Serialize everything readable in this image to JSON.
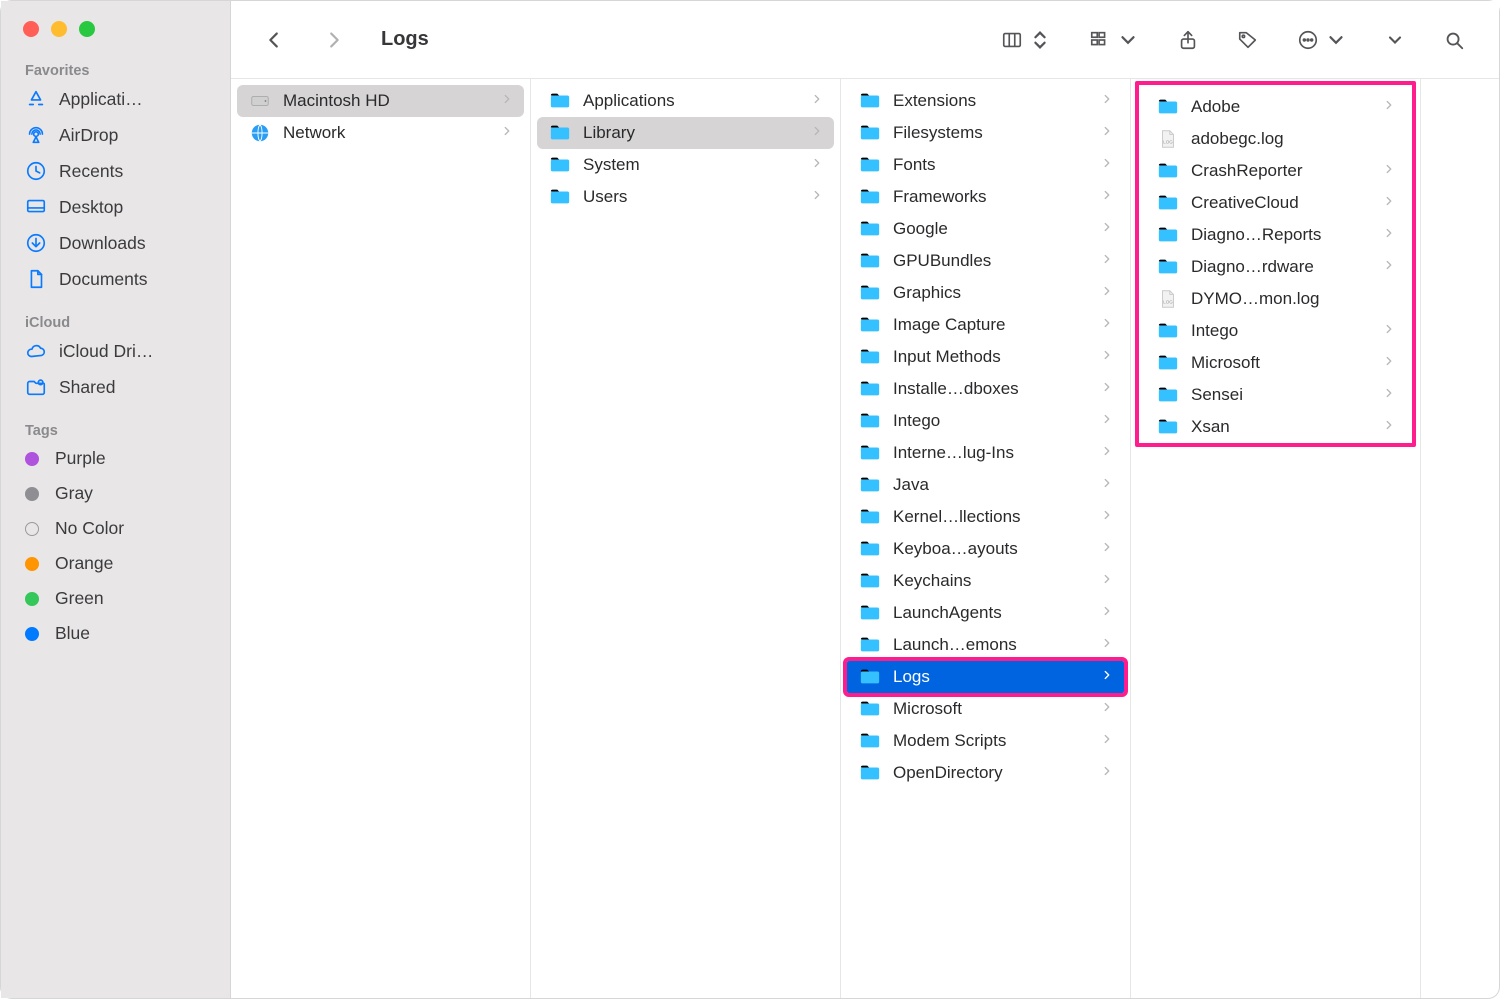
{
  "window": {
    "title": "Logs"
  },
  "sidebar": {
    "favorites_label": "Favorites",
    "favorites": [
      {
        "label": "Applicati…",
        "icon": "appstore"
      },
      {
        "label": "AirDrop",
        "icon": "airdrop"
      },
      {
        "label": "Recents",
        "icon": "clock"
      },
      {
        "label": "Desktop",
        "icon": "desktop"
      },
      {
        "label": "Downloads",
        "icon": "download"
      },
      {
        "label": "Documents",
        "icon": "doc"
      }
    ],
    "icloud_label": "iCloud",
    "icloud": [
      {
        "label": "iCloud Dri…",
        "icon": "cloud"
      },
      {
        "label": "Shared",
        "icon": "shared"
      }
    ],
    "tags_label": "Tags",
    "tags": [
      {
        "label": "Purple",
        "color": "#af52de"
      },
      {
        "label": "Gray",
        "color": "#8e8e93"
      },
      {
        "label": "No Color",
        "color": "transparent"
      },
      {
        "label": "Orange",
        "color": "#ff9500"
      },
      {
        "label": "Green",
        "color": "#34c759"
      },
      {
        "label": "Blue",
        "color": "#007aff"
      }
    ]
  },
  "columns": [
    {
      "items": [
        {
          "label": "Macintosh HD",
          "icon": "hd",
          "chevron": true,
          "selected": "gray"
        },
        {
          "label": "Network",
          "icon": "globe",
          "chevron": true
        }
      ]
    },
    {
      "items": [
        {
          "label": "Applications",
          "icon": "folder",
          "chevron": true
        },
        {
          "label": "Library",
          "icon": "folder",
          "chevron": true,
          "selected": "gray"
        },
        {
          "label": "System",
          "icon": "folder",
          "chevron": true
        },
        {
          "label": "Users",
          "icon": "folder",
          "chevron": true
        }
      ]
    },
    {
      "items": [
        {
          "label": "Extensions",
          "icon": "folder",
          "chevron": true
        },
        {
          "label": "Filesystems",
          "icon": "folder",
          "chevron": true
        },
        {
          "label": "Fonts",
          "icon": "folder",
          "chevron": true
        },
        {
          "label": "Frameworks",
          "icon": "folder",
          "chevron": true
        },
        {
          "label": "Google",
          "icon": "folder",
          "chevron": true
        },
        {
          "label": "GPUBundles",
          "icon": "folder",
          "chevron": true
        },
        {
          "label": "Graphics",
          "icon": "folder",
          "chevron": true
        },
        {
          "label": "Image Capture",
          "icon": "folder",
          "chevron": true
        },
        {
          "label": "Input Methods",
          "icon": "folder",
          "chevron": true
        },
        {
          "label": "Installe…dboxes",
          "icon": "folder",
          "chevron": true
        },
        {
          "label": "Intego",
          "icon": "folder",
          "chevron": true
        },
        {
          "label": "Interne…lug-Ins",
          "icon": "folder",
          "chevron": true
        },
        {
          "label": "Java",
          "icon": "folder",
          "chevron": true
        },
        {
          "label": "Kernel…llections",
          "icon": "folder",
          "chevron": true
        },
        {
          "label": "Keyboa…ayouts",
          "icon": "folder",
          "chevron": true
        },
        {
          "label": "Keychains",
          "icon": "folder",
          "chevron": true
        },
        {
          "label": "LaunchAgents",
          "icon": "folder",
          "chevron": true
        },
        {
          "label": "Launch…emons",
          "icon": "folder",
          "chevron": true
        },
        {
          "label": "Logs",
          "icon": "folder",
          "chevron": true,
          "selected": "blue"
        },
        {
          "label": "Microsoft",
          "icon": "folder",
          "chevron": true
        },
        {
          "label": "Modem Scripts",
          "icon": "folder",
          "chevron": true
        },
        {
          "label": "OpenDirectory",
          "icon": "folder",
          "chevron": true
        }
      ],
      "pink_outline_selected": true
    },
    {
      "pink_outline_column": true,
      "items": [
        {
          "label": "Adobe",
          "icon": "folder",
          "chevron": true
        },
        {
          "label": "adobegc.log",
          "icon": "file",
          "chevron": false
        },
        {
          "label": "CrashReporter",
          "icon": "folder",
          "chevron": true
        },
        {
          "label": "CreativeCloud",
          "icon": "folder",
          "chevron": true
        },
        {
          "label": "Diagno…Reports",
          "icon": "folder",
          "chevron": true
        },
        {
          "label": "Diagno…rdware",
          "icon": "folder",
          "chevron": true
        },
        {
          "label": "DYMO…mon.log",
          "icon": "file",
          "chevron": false
        },
        {
          "label": "Intego",
          "icon": "folder",
          "chevron": true
        },
        {
          "label": "Microsoft",
          "icon": "folder",
          "chevron": true
        },
        {
          "label": "Sensei",
          "icon": "folder",
          "chevron": true
        },
        {
          "label": "Xsan",
          "icon": "folder",
          "chevron": true
        }
      ]
    }
  ]
}
